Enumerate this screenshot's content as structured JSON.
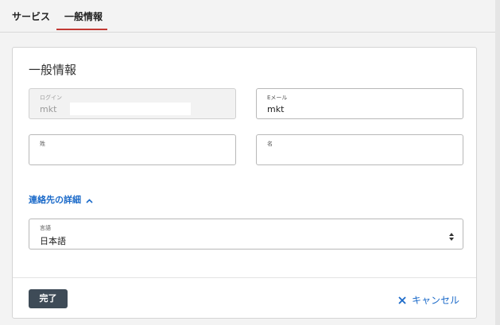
{
  "tabs": [
    {
      "label": "サービス",
      "active": false
    },
    {
      "label": "一般情報",
      "active": true
    }
  ],
  "colors": {
    "accent": "#c23934",
    "link": "#1b6ac9",
    "primary_button": "#3e4b57"
  },
  "section": {
    "title": "一般情報"
  },
  "fields": {
    "login": {
      "label": "ログイン",
      "value": "mkt"
    },
    "email": {
      "label": "Eメール",
      "value": "mkt"
    },
    "last_name": {
      "label": "姓",
      "value": ""
    },
    "first_name": {
      "label": "名",
      "value": ""
    },
    "language": {
      "label": "言語",
      "value": "日本語"
    }
  },
  "contact_details": {
    "label": "連絡先の詳細",
    "icon": "chevron-up-icon"
  },
  "footer": {
    "done_label": "完了",
    "cancel_label": "キャンセル",
    "cancel_icon": "close-icon"
  }
}
